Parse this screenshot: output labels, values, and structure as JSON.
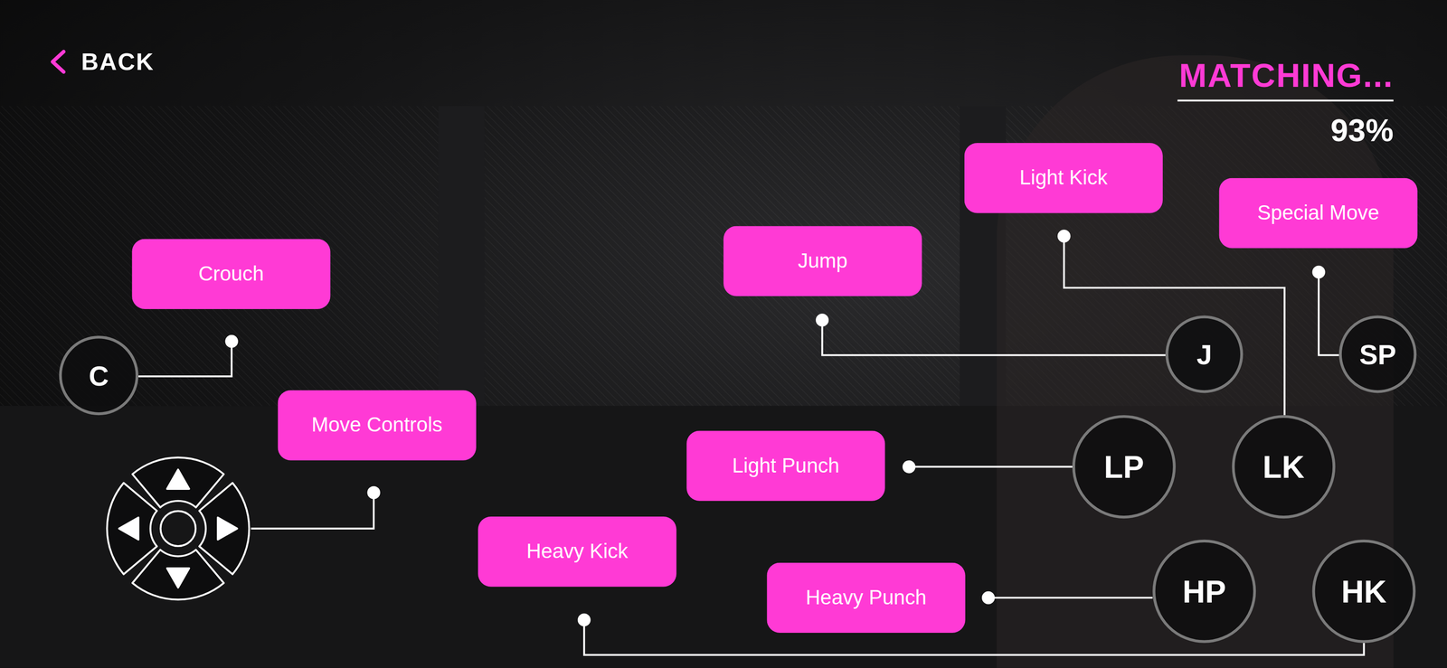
{
  "back": {
    "label": "BACK"
  },
  "matching": {
    "label": "MATCHING...",
    "percent": "93%"
  },
  "controls": [
    {
      "label": "Crouch",
      "kind": "button",
      "key": "C"
    },
    {
      "label": "Move Controls",
      "kind": "dpad"
    },
    {
      "label": "Jump",
      "kind": "button",
      "key": "J"
    },
    {
      "label": "Light Kick",
      "kind": "button",
      "key": "LK"
    },
    {
      "label": "Special Move",
      "kind": "button",
      "key": "SP"
    },
    {
      "label": "Light Punch",
      "kind": "button",
      "key": "LP"
    },
    {
      "label": "Heavy Kick",
      "kind": "button",
      "key": "HK"
    },
    {
      "label": "Heavy Punch",
      "kind": "button",
      "key": "HP"
    }
  ]
}
